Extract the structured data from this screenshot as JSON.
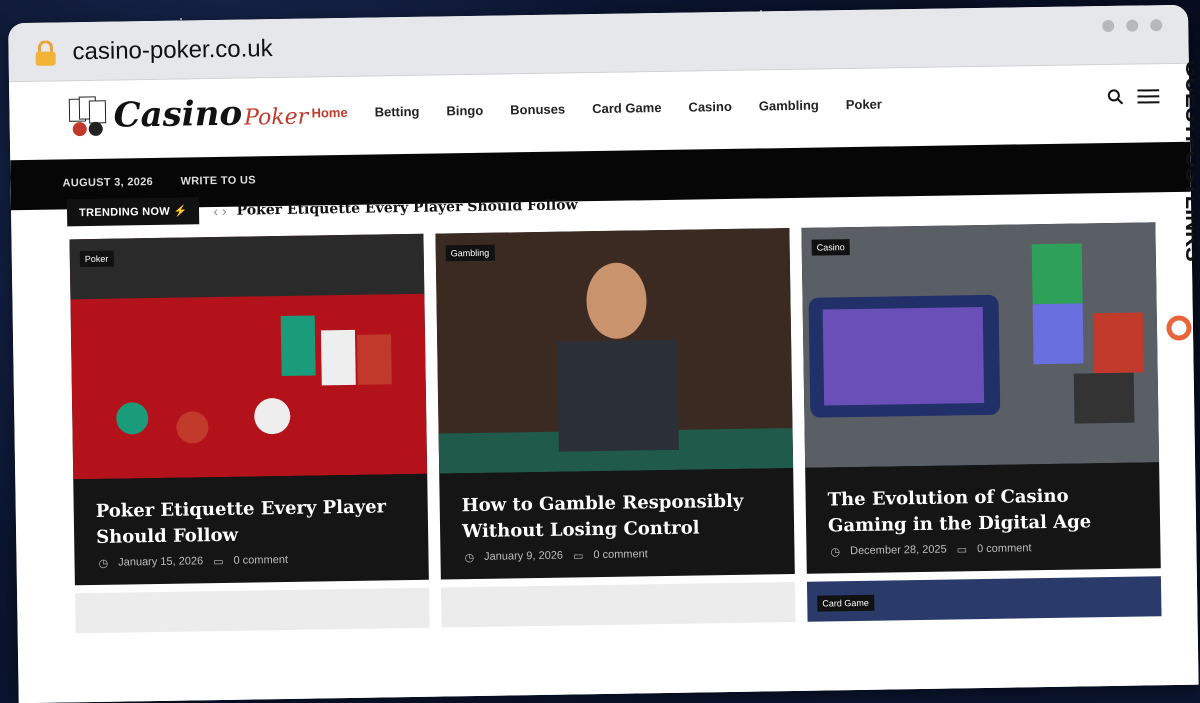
{
  "browser": {
    "url": "casino-poker.co.uk"
  },
  "site": {
    "logo_main": "Casino",
    "logo_sub": "Poker",
    "nav": [
      "Home",
      "Betting",
      "Bingo",
      "Bonuses",
      "Card Game",
      "Casino",
      "Gambling",
      "Poker"
    ],
    "topbar": {
      "date": "AUGUST 3, 2026",
      "link": "WRITE TO US"
    },
    "trending": {
      "badge": "TRENDING NOW",
      "title": "Poker Etiquette Every Player Should Follow"
    },
    "cards": [
      {
        "category": "Poker",
        "title": "Poker Etiquette Every Player Should Follow",
        "date": "January 15, 2026",
        "comments": "0 comment"
      },
      {
        "category": "Gambling",
        "title": "How to Gamble Responsibly Without Losing Control",
        "date": "January 9, 2026",
        "comments": "0 comment"
      },
      {
        "category": "Casino",
        "title": "The Evolution of Casino Gaming in the Digital Age",
        "date": "December 28, 2025",
        "comments": "0 comment"
      }
    ],
    "row2_category": "Card Game"
  },
  "watermark": "GUESTPOSTLINKS",
  "colors": {
    "accent": "#c0392b",
    "topbar": "#060606",
    "card": "#151515"
  }
}
